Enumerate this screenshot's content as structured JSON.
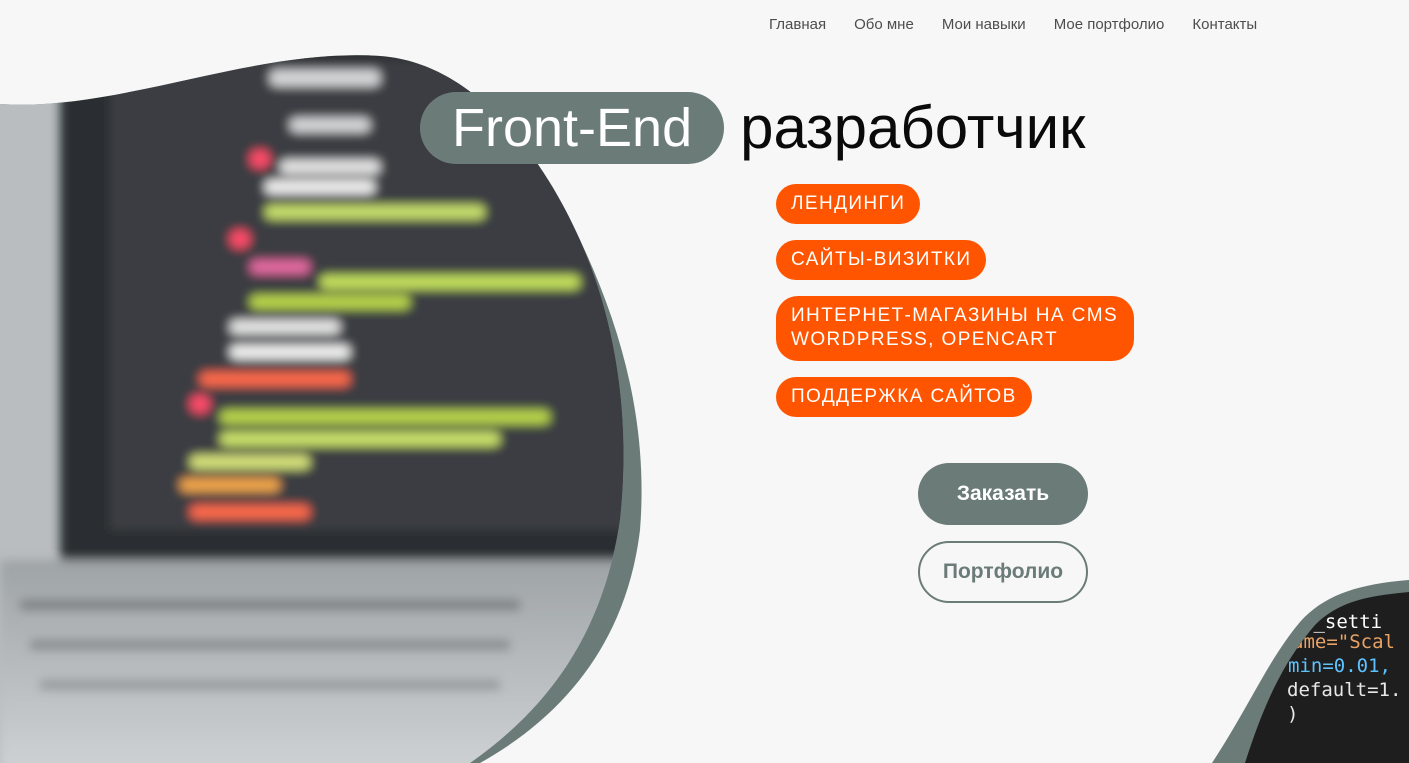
{
  "nav": {
    "items": [
      "Главная",
      "Обо мне",
      "Мои навыки",
      "Мое портфолио",
      "Контакты"
    ]
  },
  "hero": {
    "title_highlight": "Front-End",
    "title_rest": "разработчик",
    "services": [
      "ЛЕНДИНГИ",
      "САЙТЫ-ВИЗИТКИ",
      "ИНТЕРНЕТ-МАГАЗИНЫ НА CMS\nWORDPRESS, OPENCART",
      "ПОДДЕРЖКА САЙТОВ"
    ],
    "order_button": "Заказать",
    "portfolio_button": "Портфолио"
  },
  "code_snippet": {
    "lines": [
      "e_setti",
      "ame=\"Scal",
      "min=0.01,",
      "default=1.",
      ")"
    ]
  },
  "colors": {
    "accent": "#ff5500",
    "brand": "#6b7c78",
    "background": "#f7f7f7",
    "text": "#0a0a0a"
  }
}
